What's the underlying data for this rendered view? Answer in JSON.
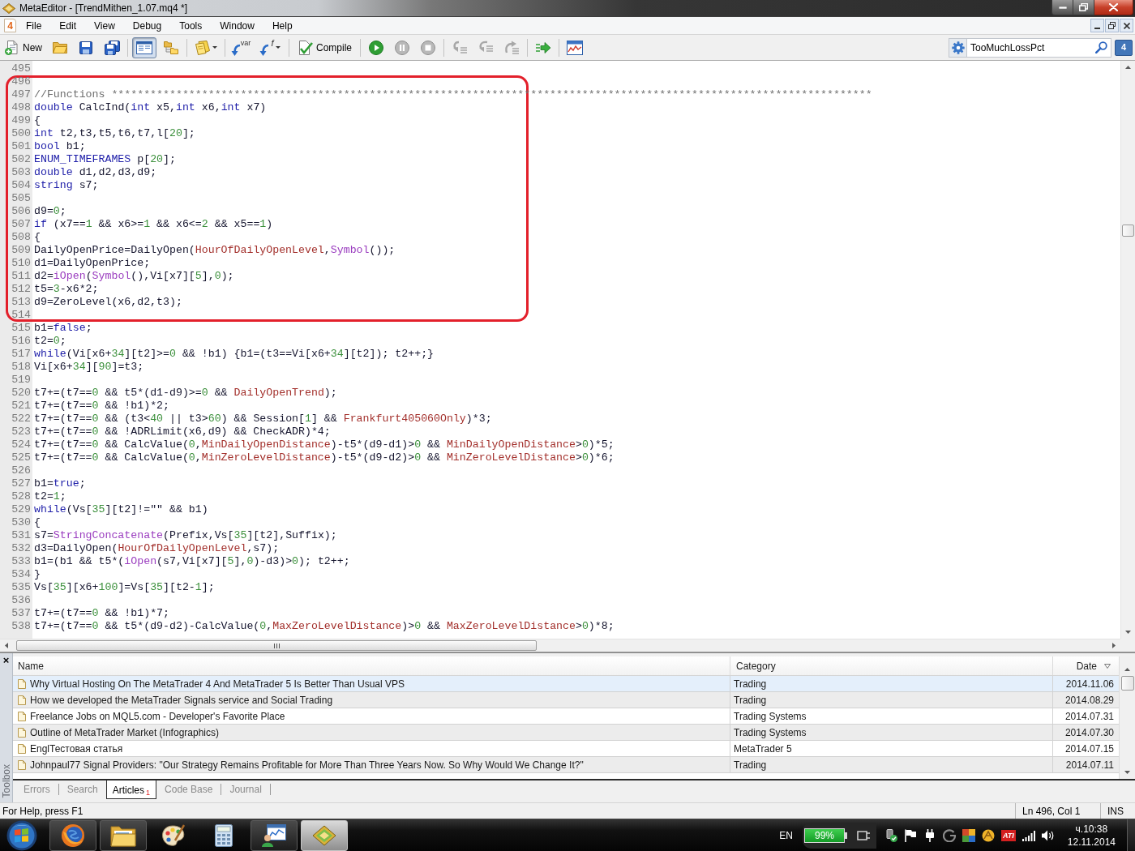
{
  "window": {
    "title": "MetaEditor - [TrendMithen_1.07.mq4 *]"
  },
  "menu_bar": {
    "document_icon_text": "4",
    "items": [
      "File",
      "Edit",
      "View",
      "Debug",
      "Tools",
      "Window",
      "Help"
    ]
  },
  "toolbar": {
    "new": {
      "label": "New"
    },
    "layout_toggle": {
      "pressed": true
    },
    "variable": {
      "label": "var"
    },
    "function": {
      "label": "f"
    },
    "compile": {
      "label": "Compile"
    },
    "debug": [
      {
        "disabled": false
      },
      {
        "disabled": true
      },
      {
        "disabled": true
      },
      {
        "disabled": true
      },
      {
        "disabled": true
      },
      {
        "disabled": true
      }
    ],
    "search": {
      "value": "TooMuchLossPct"
    },
    "messages": {
      "count": "4"
    }
  },
  "editor": {
    "blocks": [
      {
        "highlighted": false,
        "lines": [
          {
            "number": "495"
          }
        ]
      },
      {
        "highlighted": true,
        "lines": [
          {
            "number": "496"
          },
          {
            "number": "497",
            "tokens": [
              {
                "kind": "comment",
                "text": "//Functions **********************************************************************************************************************"
              }
            ]
          },
          {
            "number": "498",
            "tokens": [
              {
                "kind": "keyword",
                "text": "double"
              },
              {
                "kind": "plain",
                "text": " CalcInd("
              },
              {
                "kind": "keyword",
                "text": "int"
              },
              {
                "kind": "plain",
                "text": " x5,"
              },
              {
                "kind": "keyword",
                "text": "int"
              },
              {
                "kind": "plain",
                "text": " x6,"
              },
              {
                "kind": "keyword",
                "text": "int"
              },
              {
                "kind": "plain",
                "text": " x7)"
              }
            ]
          },
          {
            "number": "499",
            "tokens": [
              {
                "kind": "plain",
                "text": "{"
              }
            ]
          },
          {
            "number": "500",
            "tokens": [
              {
                "kind": "keyword",
                "text": "int"
              },
              {
                "kind": "plain",
                "text": " t2,t3,t5,t6,t7,l["
              },
              {
                "kind": "number",
                "text": "20"
              },
              {
                "kind": "plain",
                "text": "];"
              }
            ]
          },
          {
            "number": "501",
            "tokens": [
              {
                "kind": "keyword",
                "text": "bool"
              },
              {
                "kind": "plain",
                "text": " b1;"
              }
            ]
          },
          {
            "number": "502",
            "tokens": [
              {
                "kind": "keyword",
                "text": "ENUM_TIMEFRAMES"
              },
              {
                "kind": "plain",
                "text": " p["
              },
              {
                "kind": "number",
                "text": "20"
              },
              {
                "kind": "plain",
                "text": "];"
              }
            ]
          },
          {
            "number": "503",
            "tokens": [
              {
                "kind": "keyword",
                "text": "double"
              },
              {
                "kind": "plain",
                "text": " d1,d2,d3,d9;"
              }
            ]
          },
          {
            "number": "504",
            "tokens": [
              {
                "kind": "keyword",
                "text": "string"
              },
              {
                "kind": "plain",
                "text": " s7;"
              }
            ]
          },
          {
            "number": "505"
          },
          {
            "number": "506",
            "tokens": [
              {
                "kind": "plain",
                "text": "d9="
              },
              {
                "kind": "number",
                "text": "0"
              },
              {
                "kind": "plain",
                "text": ";"
              }
            ]
          },
          {
            "number": "507",
            "tokens": [
              {
                "kind": "keyword",
                "text": "if"
              },
              {
                "kind": "plain",
                "text": " (x7=="
              },
              {
                "kind": "number",
                "text": "1"
              },
              {
                "kind": "plain",
                "text": " && x6>="
              },
              {
                "kind": "number",
                "text": "1"
              },
              {
                "kind": "plain",
                "text": " && x6<="
              },
              {
                "kind": "number",
                "text": "2"
              },
              {
                "kind": "plain",
                "text": " && x5=="
              },
              {
                "kind": "number",
                "text": "1"
              },
              {
                "kind": "plain",
                "text": ")"
              }
            ]
          },
          {
            "number": "508",
            "tokens": [
              {
                "kind": "plain",
                "text": "{"
              }
            ]
          },
          {
            "number": "509",
            "tokens": [
              {
                "kind": "plain",
                "text": "DailyOpenPrice=DailyOpen("
              },
              {
                "kind": "input",
                "text": "HourOfDailyOpenLevel"
              },
              {
                "kind": "plain",
                "text": ","
              },
              {
                "kind": "function",
                "text": "Symbol"
              },
              {
                "kind": "plain",
                "text": "());"
              }
            ]
          },
          {
            "number": "510",
            "tokens": [
              {
                "kind": "plain",
                "text": "d1=DailyOpenPrice;"
              }
            ]
          },
          {
            "number": "511",
            "tokens": [
              {
                "kind": "plain",
                "text": "d2="
              },
              {
                "kind": "function",
                "text": "iOpen"
              },
              {
                "kind": "plain",
                "text": "("
              },
              {
                "kind": "function",
                "text": "Symbol"
              },
              {
                "kind": "plain",
                "text": "(),Vi[x7]["
              },
              {
                "kind": "number",
                "text": "5"
              },
              {
                "kind": "plain",
                "text": "],"
              },
              {
                "kind": "number",
                "text": "0"
              },
              {
                "kind": "plain",
                "text": ");"
              }
            ]
          },
          {
            "number": "512",
            "tokens": [
              {
                "kind": "plain",
                "text": "t5="
              },
              {
                "kind": "number",
                "text": "3"
              },
              {
                "kind": "plain",
                "text": "-x6*2;"
              }
            ]
          },
          {
            "number": "513",
            "tokens": [
              {
                "kind": "plain",
                "text": "d9=ZeroLevel(x6,d2,t3);"
              }
            ]
          },
          {
            "number": "514"
          }
        ]
      },
      {
        "highlighted": false,
        "lines": [
          {
            "number": "515",
            "tokens": [
              {
                "kind": "plain",
                "text": "b1="
              },
              {
                "kind": "keyword",
                "text": "false"
              },
              {
                "kind": "plain",
                "text": ";"
              }
            ]
          },
          {
            "number": "516",
            "tokens": [
              {
                "kind": "plain",
                "text": "t2="
              },
              {
                "kind": "number",
                "text": "0"
              },
              {
                "kind": "plain",
                "text": ";"
              }
            ]
          },
          {
            "number": "517",
            "tokens": [
              {
                "kind": "keyword",
                "text": "while"
              },
              {
                "kind": "plain",
                "text": "(Vi[x6+"
              },
              {
                "kind": "number",
                "text": "34"
              },
              {
                "kind": "plain",
                "text": "][t2]>="
              },
              {
                "kind": "number",
                "text": "0"
              },
              {
                "kind": "plain",
                "text": " && !b1) {b1=(t3==Vi[x6+"
              },
              {
                "kind": "number",
                "text": "34"
              },
              {
                "kind": "plain",
                "text": "][t2]); t2++;}"
              }
            ]
          },
          {
            "number": "518",
            "tokens": [
              {
                "kind": "plain",
                "text": "Vi[x6+"
              },
              {
                "kind": "number",
                "text": "34"
              },
              {
                "kind": "plain",
                "text": "]["
              },
              {
                "kind": "number",
                "text": "90"
              },
              {
                "kind": "plain",
                "text": "]=t3;"
              }
            ]
          },
          {
            "number": "519"
          },
          {
            "number": "520",
            "tokens": [
              {
                "kind": "plain",
                "text": "t7+=(t7=="
              },
              {
                "kind": "number",
                "text": "0"
              },
              {
                "kind": "plain",
                "text": " && t5*(d1-d9)>="
              },
              {
                "kind": "number",
                "text": "0"
              },
              {
                "kind": "plain",
                "text": " && "
              },
              {
                "kind": "input",
                "text": "DailyOpenTrend"
              },
              {
                "kind": "plain",
                "text": ");"
              }
            ]
          },
          {
            "number": "521",
            "tokens": [
              {
                "kind": "plain",
                "text": "t7+=(t7=="
              },
              {
                "kind": "number",
                "text": "0"
              },
              {
                "kind": "plain",
                "text": " && !b1)*2;"
              }
            ]
          },
          {
            "number": "522",
            "tokens": [
              {
                "kind": "plain",
                "text": "t7+=(t7=="
              },
              {
                "kind": "number",
                "text": "0"
              },
              {
                "kind": "plain",
                "text": " && (t3<"
              },
              {
                "kind": "number",
                "text": "40"
              },
              {
                "kind": "plain",
                "text": " || t3>"
              },
              {
                "kind": "number",
                "text": "60"
              },
              {
                "kind": "plain",
                "text": ") && Session["
              },
              {
                "kind": "number",
                "text": "1"
              },
              {
                "kind": "plain",
                "text": "] && "
              },
              {
                "kind": "input",
                "text": "Frankfurt405060Only"
              },
              {
                "kind": "plain",
                "text": ")*3;"
              }
            ]
          },
          {
            "number": "523",
            "tokens": [
              {
                "kind": "plain",
                "text": "t7+=(t7=="
              },
              {
                "kind": "number",
                "text": "0"
              },
              {
                "kind": "plain",
                "text": " && !ADRLimit(x6,d9) && CheckADR)*4;"
              }
            ]
          },
          {
            "number": "524",
            "tokens": [
              {
                "kind": "plain",
                "text": "t7+=(t7=="
              },
              {
                "kind": "number",
                "text": "0"
              },
              {
                "kind": "plain",
                "text": " && CalcValue("
              },
              {
                "kind": "number",
                "text": "0"
              },
              {
                "kind": "plain",
                "text": ","
              },
              {
                "kind": "input",
                "text": "MinDailyOpenDistance"
              },
              {
                "kind": "plain",
                "text": ")-t5*(d9-d1)>"
              },
              {
                "kind": "number",
                "text": "0"
              },
              {
                "kind": "plain",
                "text": " && "
              },
              {
                "kind": "input",
                "text": "MinDailyOpenDistance"
              },
              {
                "kind": "plain",
                "text": ">"
              },
              {
                "kind": "number",
                "text": "0"
              },
              {
                "kind": "plain",
                "text": ")*5;"
              }
            ]
          },
          {
            "number": "525",
            "tokens": [
              {
                "kind": "plain",
                "text": "t7+=(t7=="
              },
              {
                "kind": "number",
                "text": "0"
              },
              {
                "kind": "plain",
                "text": " && CalcValue("
              },
              {
                "kind": "number",
                "text": "0"
              },
              {
                "kind": "plain",
                "text": ","
              },
              {
                "kind": "input",
                "text": "MinZeroLevelDistance"
              },
              {
                "kind": "plain",
                "text": ")-t5*(d9-d2)>"
              },
              {
                "kind": "number",
                "text": "0"
              },
              {
                "kind": "plain",
                "text": " && "
              },
              {
                "kind": "input",
                "text": "MinZeroLevelDistance"
              },
              {
                "kind": "plain",
                "text": ">"
              },
              {
                "kind": "number",
                "text": "0"
              },
              {
                "kind": "plain",
                "text": ")*6;"
              }
            ]
          },
          {
            "number": "526"
          },
          {
            "number": "527",
            "tokens": [
              {
                "kind": "plain",
                "text": "b1="
              },
              {
                "kind": "keyword",
                "text": "true"
              },
              {
                "kind": "plain",
                "text": ";"
              }
            ]
          },
          {
            "number": "528",
            "tokens": [
              {
                "kind": "plain",
                "text": "t2="
              },
              {
                "kind": "number",
                "text": "1"
              },
              {
                "kind": "plain",
                "text": ";"
              }
            ]
          },
          {
            "number": "529",
            "tokens": [
              {
                "kind": "keyword",
                "text": "while"
              },
              {
                "kind": "plain",
                "text": "(Vs["
              },
              {
                "kind": "number",
                "text": "35"
              },
              {
                "kind": "plain",
                "text": "][t2]!=\"\" && b1)"
              }
            ]
          },
          {
            "number": "530",
            "tokens": [
              {
                "kind": "plain",
                "text": "{"
              }
            ]
          },
          {
            "number": "531",
            "tokens": [
              {
                "kind": "plain",
                "text": "s7="
              },
              {
                "kind": "function",
                "text": "StringConcatenate"
              },
              {
                "kind": "plain",
                "text": "(Prefix,Vs["
              },
              {
                "kind": "number",
                "text": "35"
              },
              {
                "kind": "plain",
                "text": "][t2],Suffix);"
              }
            ]
          },
          {
            "number": "532",
            "tokens": [
              {
                "kind": "plain",
                "text": "d3=DailyOpen("
              },
              {
                "kind": "input",
                "text": "HourOfDailyOpenLevel"
              },
              {
                "kind": "plain",
                "text": ",s7);"
              }
            ]
          },
          {
            "number": "533",
            "tokens": [
              {
                "kind": "plain",
                "text": "b1=(b1 && t5*("
              },
              {
                "kind": "function",
                "text": "iOpen"
              },
              {
                "kind": "plain",
                "text": "(s7,Vi[x7]["
              },
              {
                "kind": "number",
                "text": "5"
              },
              {
                "kind": "plain",
                "text": "],"
              },
              {
                "kind": "number",
                "text": "0"
              },
              {
                "kind": "plain",
                "text": ")-d3)>"
              },
              {
                "kind": "number",
                "text": "0"
              },
              {
                "kind": "plain",
                "text": "); t2++;"
              }
            ]
          },
          {
            "number": "534",
            "tokens": [
              {
                "kind": "plain",
                "text": "}"
              }
            ]
          },
          {
            "number": "535",
            "tokens": [
              {
                "kind": "plain",
                "text": "Vs["
              },
              {
                "kind": "number",
                "text": "35"
              },
              {
                "kind": "plain",
                "text": "][x6+"
              },
              {
                "kind": "number",
                "text": "100"
              },
              {
                "kind": "plain",
                "text": "]=Vs["
              },
              {
                "kind": "number",
                "text": "35"
              },
              {
                "kind": "plain",
                "text": "][t2-"
              },
              {
                "kind": "number",
                "text": "1"
              },
              {
                "kind": "plain",
                "text": "];"
              }
            ]
          },
          {
            "number": "536"
          },
          {
            "number": "537",
            "tokens": [
              {
                "kind": "plain",
                "text": "t7+=(t7=="
              },
              {
                "kind": "number",
                "text": "0"
              },
              {
                "kind": "plain",
                "text": " && !b1)*7;"
              }
            ]
          },
          {
            "number": "538",
            "tokens": [
              {
                "kind": "plain",
                "text": "t7+=(t7=="
              },
              {
                "kind": "number",
                "text": "0"
              },
              {
                "kind": "plain",
                "text": " && t5*(d9-d2)-CalcValue("
              },
              {
                "kind": "number",
                "text": "0"
              },
              {
                "kind": "plain",
                "text": ","
              },
              {
                "kind": "input",
                "text": "MaxZeroLevelDistance"
              },
              {
                "kind": "plain",
                "text": ")>"
              },
              {
                "kind": "number",
                "text": "0"
              },
              {
                "kind": "plain",
                "text": " && "
              },
              {
                "kind": "input",
                "text": "MaxZeroLevelDistance"
              },
              {
                "kind": "plain",
                "text": ">"
              },
              {
                "kind": "number",
                "text": "0"
              },
              {
                "kind": "plain",
                "text": ")*8;"
              }
            ]
          }
        ]
      }
    ]
  },
  "toolbox": {
    "close": "×",
    "title": "Toolbox",
    "articles": {
      "columns": [
        {
          "label": "Name",
          "sorted": false
        },
        {
          "label": "Category",
          "sorted": false
        },
        {
          "label": "Date",
          "sorted": true
        }
      ],
      "rows": [
        {
          "name": "Why Virtual Hosting On The MetaTrader 4 And MetaTrader 5 Is Better Than Usual VPS",
          "category": "Trading",
          "date": "2014.11.06",
          "selected": true
        },
        {
          "name": "How we developed the MetaTrader Signals service and Social Trading",
          "category": "Trading",
          "date": "2014.08.29",
          "selected": false
        },
        {
          "name": "Freelance Jobs on MQL5.com - Developer's Favorite Place",
          "category": "Trading Systems",
          "date": "2014.07.31",
          "selected": false
        },
        {
          "name": "Outline of MetaTrader Market (Infographics)",
          "category": "Trading Systems",
          "date": "2014.07.30",
          "selected": false
        },
        {
          "name": "EnglТестовая статья",
          "category": "MetaTrader 5",
          "date": "2014.07.15",
          "selected": false
        },
        {
          "name": "Johnpaul77 Signal Providers: \"Our Strategy Remains Profitable for More Than Three Years Now. So Why Would We Change It?\"",
          "category": "Trading",
          "date": "2014.07.11",
          "selected": false
        }
      ]
    },
    "tabs": [
      {
        "label": "Errors",
        "selected": false
      },
      {
        "label": "Search",
        "selected": false
      },
      {
        "label": "Articles",
        "selected": true,
        "badge": "1"
      },
      {
        "label": "Code Base",
        "selected": false
      },
      {
        "label": "Journal",
        "selected": false
      }
    ]
  },
  "status_bar": {
    "help": "For Help, press F1",
    "position": "Ln 496, Col 1",
    "mode": "INS"
  },
  "taskbar": {
    "apps": [
      {
        "running": true,
        "selected": false
      },
      {
        "running": true,
        "selected": false
      },
      {
        "running": false,
        "selected": false
      },
      {
        "running": false,
        "selected": false
      },
      {
        "running": true,
        "selected": false
      },
      {
        "running": true,
        "selected": true
      }
    ],
    "language": "EN",
    "battery": "99%",
    "tray_logo": "ATI",
    "clock": {
      "time": "ч.10:38",
      "date": "12.11.2014"
    }
  }
}
